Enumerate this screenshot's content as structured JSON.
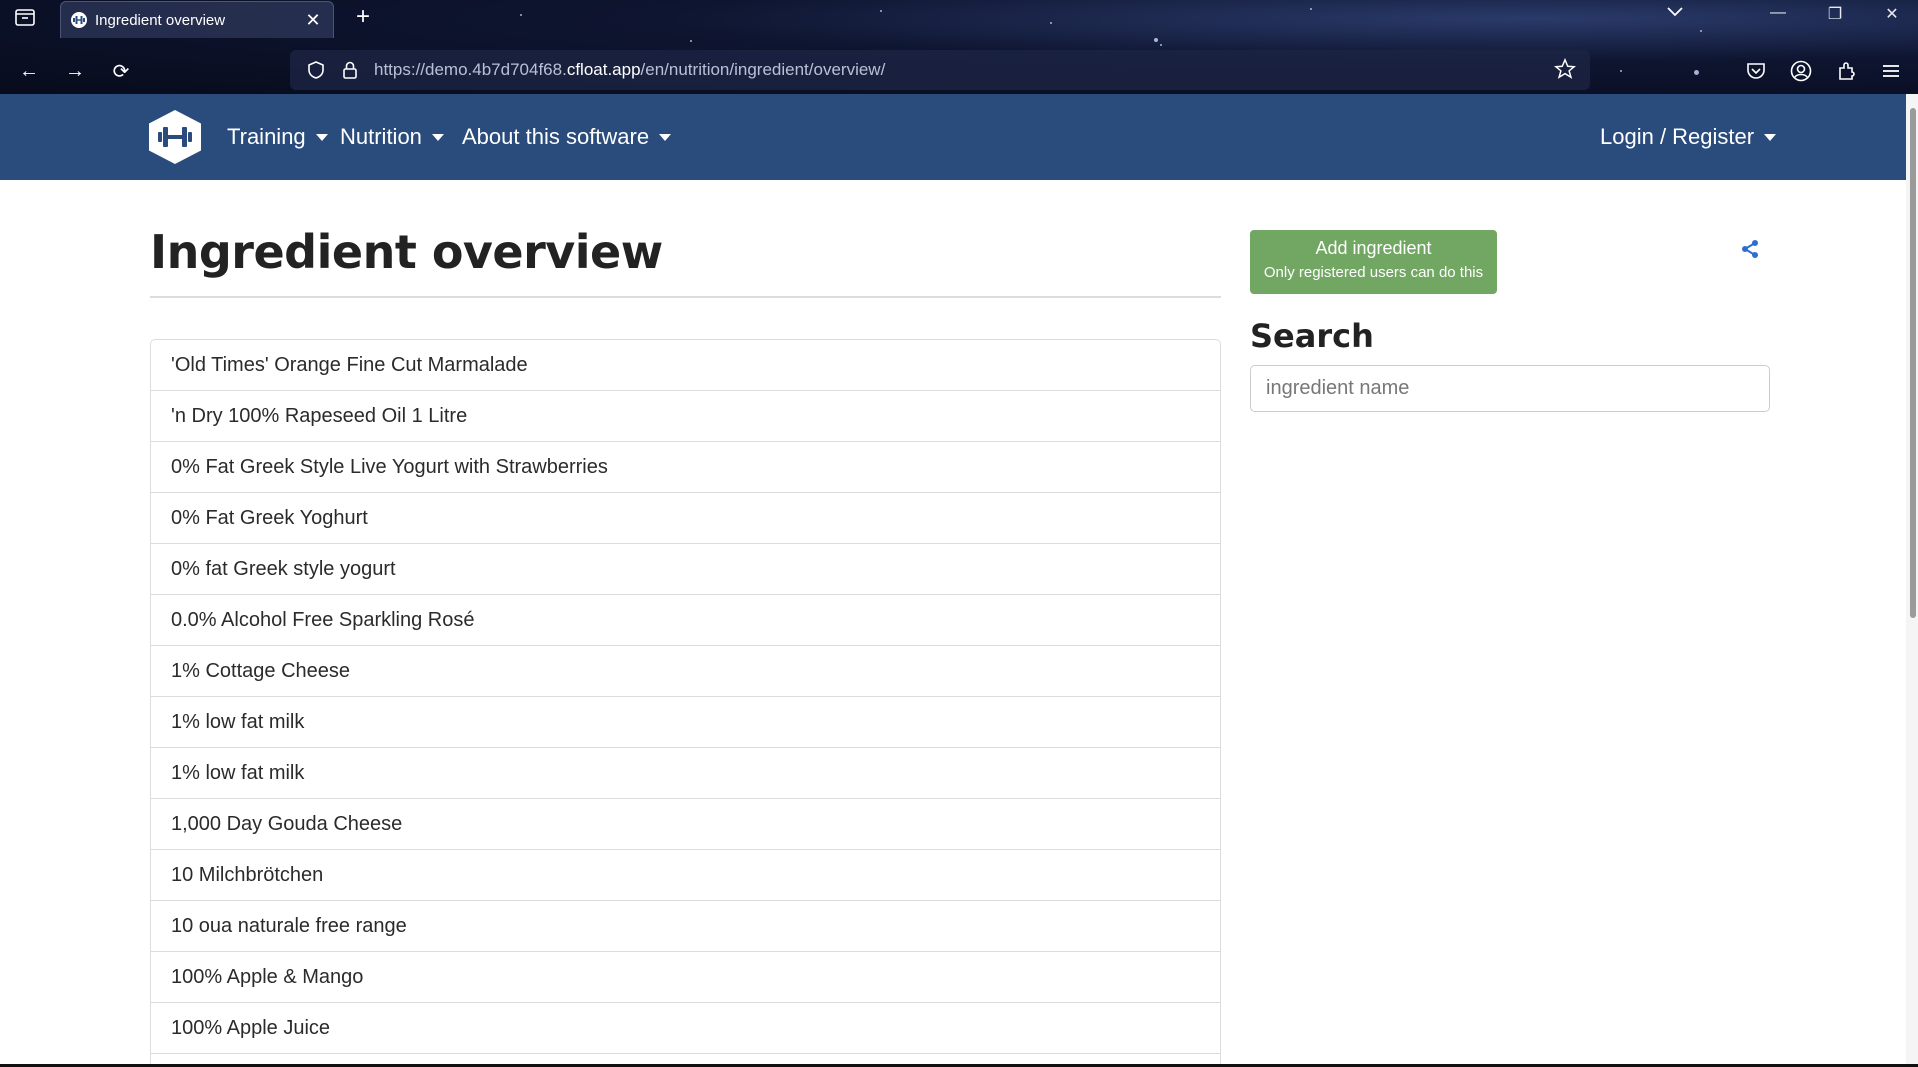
{
  "browser": {
    "tab_title": "Ingredient overview",
    "url_prefix": "https://demo.4b7d704f68.",
    "url_domain": "cfloat.app",
    "url_path": "/en/nutrition/ingredient/overview/"
  },
  "nav": {
    "training": "Training",
    "nutrition": "Nutrition",
    "about": "About this software",
    "login": "Login / Register",
    "brand_color": "#2a4c7d"
  },
  "main": {
    "title": "Ingredient overview",
    "ingredients": [
      "'Old Times' Orange Fine Cut Marmalade",
      "'n Dry 100% Rapeseed Oil 1 Litre",
      "0% Fat Greek Style Live Yogurt with Strawberries",
      "0% Fat Greek Yoghurt",
      "0% fat Greek style yogurt",
      "0.0% Alcohol Free Sparkling Rosé",
      "1% Cottage Cheese",
      "1% low fat milk",
      "1% low fat milk",
      "1,000 Day Gouda Cheese",
      "10 Milchbrötchen",
      "10 oua naturale free range",
      "100% Apple & Mango",
      "100% Apple Juice",
      ""
    ]
  },
  "sidebar": {
    "add_label": "Add ingredient",
    "add_note": "Only registered users can do this",
    "add_color": "#72a663",
    "search_heading": "Search",
    "search_placeholder": "ingredient name",
    "share_icon": "share-icon"
  }
}
